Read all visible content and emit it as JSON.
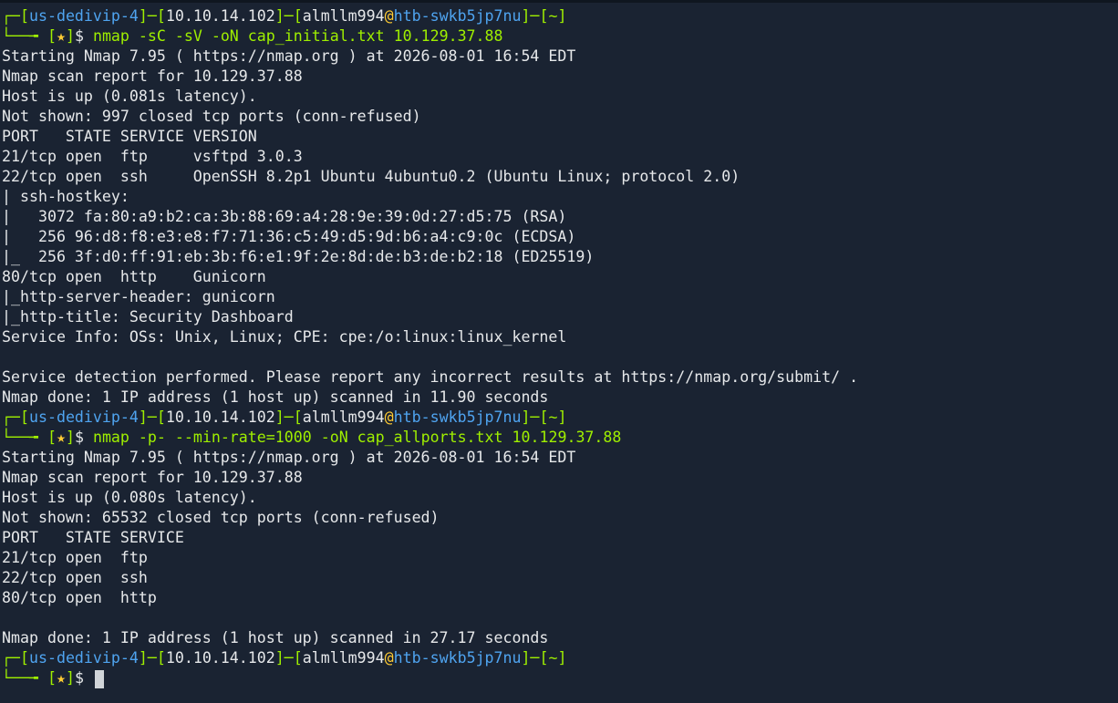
{
  "prompt": {
    "host": "us-dedivip-4",
    "ip": "10.10.14.102",
    "user": "almllm994",
    "machine": "htb-swkb5jp7nu",
    "dir": "~",
    "star": "★",
    "dollar": "$"
  },
  "commands": [
    "nmap -sC -sV -oN cap_initial.txt 10.129.37.88",
    "nmap -p- --min-rate=1000 -oN cap_allports.txt 10.129.37.88"
  ],
  "outputs": [
    [
      "Starting Nmap 7.95 ( https://nmap.org ) at 2026-08-01 16:54 EDT",
      "Nmap scan report for 10.129.37.88",
      "Host is up (0.081s latency).",
      "Not shown: 997 closed tcp ports (conn-refused)",
      "PORT   STATE SERVICE VERSION",
      "21/tcp open  ftp     vsftpd 3.0.3",
      "22/tcp open  ssh     OpenSSH 8.2p1 Ubuntu 4ubuntu0.2 (Ubuntu Linux; protocol 2.0)",
      "| ssh-hostkey: ",
      "|   3072 fa:80:a9:b2:ca:3b:88:69:a4:28:9e:39:0d:27:d5:75 (RSA)",
      "|   256 96:d8:f8:e3:e8:f7:71:36:c5:49:d5:9d:b6:a4:c9:0c (ECDSA)",
      "|_  256 3f:d0:ff:91:eb:3b:f6:e1:9f:2e:8d:de:b3:de:b2:18 (ED25519)",
      "80/tcp open  http    Gunicorn",
      "|_http-server-header: gunicorn",
      "|_http-title: Security Dashboard",
      "Service Info: OSs: Unix, Linux; CPE: cpe:/o:linux:linux_kernel",
      "",
      "Service detection performed. Please report any incorrect results at https://nmap.org/submit/ .",
      "Nmap done: 1 IP address (1 host up) scanned in 11.90 seconds"
    ],
    [
      "Starting Nmap 7.95 ( https://nmap.org ) at 2026-08-01 16:54 EDT",
      "Nmap scan report for 10.129.37.88",
      "Host is up (0.080s latency).",
      "Not shown: 65532 closed tcp ports (conn-refused)",
      "PORT   STATE SERVICE",
      "21/tcp open  ftp",
      "22/tcp open  ssh",
      "80/tcp open  http",
      "",
      "Nmap done: 1 IP address (1 host up) scanned in 27.17 seconds"
    ]
  ],
  "colors": {
    "background": "#1a2332",
    "green": "#9fef00",
    "blue": "#4fa4f0",
    "text": "#e6e8ea",
    "star": "#ffcc33"
  }
}
